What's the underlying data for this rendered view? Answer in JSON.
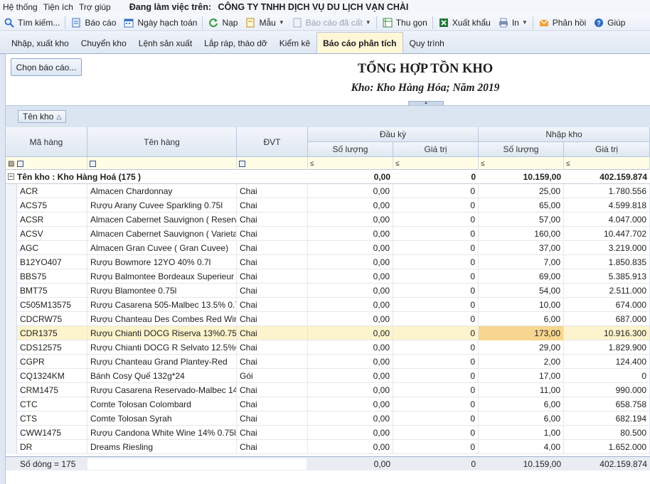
{
  "menu": {
    "items": [
      "Hệ thống",
      "Tiện ích",
      "Trợ giúp"
    ],
    "working_on_label": "Đang làm việc trên:",
    "company": "CÔNG TY TNHH DỊCH VỤ DU LỊCH VẠN CHÀI"
  },
  "toolbar": {
    "search": "Tìm kiếm...",
    "report": "Báo cáo",
    "accounting_date": "Ngày hạch toán",
    "load": "Nạp",
    "template": "Mẫu",
    "saved_report": "Báo cáo đã cất",
    "collapse": "Thu gọn",
    "export": "Xuất khẩu",
    "print": "In",
    "feedback": "Phản hồi",
    "help": "Giúp"
  },
  "tabs": [
    "Nhập, xuất kho",
    "Chuyển kho",
    "Lệnh sản xuất",
    "Lắp ráp, tháo dỡ",
    "Kiểm kê",
    "Báo cáo phân tích",
    "Quy trình"
  ],
  "report": {
    "choose_button": "Chọn báo cáo...",
    "title": "TỔNG HỢP TỒN KHO",
    "subtitle": "Kho: Kho Hàng Hóa; Năm 2019"
  },
  "group_panel": {
    "chip": "Tên kho"
  },
  "columns": {
    "code": "Mã hàng",
    "name": "Tên hàng",
    "unit": "ĐVT",
    "opening": "Đầu kỳ",
    "receipt": "Nhập kho",
    "qty": "Số lượng",
    "value": "Giá trị"
  },
  "filter_lte": "≤",
  "group_row": {
    "label": "Tên kho : Kho Hàng Hoá (175 )",
    "opening_qty": "0,00",
    "opening_value": "0",
    "receipt_qty": "10.159,00",
    "receipt_value": "402.159.874"
  },
  "rows": [
    {
      "code": "ACR",
      "name": "Almacen Chardonnay",
      "unit": "Chai",
      "oq": "0,00",
      "ov": "0",
      "rq": "25,00",
      "rv": "1.780.556"
    },
    {
      "code": "ACS75",
      "name": "Rượu Arany Cuvee Sparkling 0.75l",
      "unit": "Chai",
      "oq": "0,00",
      "ov": "0",
      "rq": "65,00",
      "rv": "4.599.818"
    },
    {
      "code": "ACSR",
      "name": "Almacen Cabernet Sauvignon ( Reserv",
      "unit": "Chai",
      "oq": "0,00",
      "ov": "0",
      "rq": "57,00",
      "rv": "4.047.000"
    },
    {
      "code": "ACSV",
      "name": "Almacen Cabernet Sauvignon ( Varietal",
      "unit": "Chai",
      "oq": "0,00",
      "ov": "0",
      "rq": "160,00",
      "rv": "10.447.702"
    },
    {
      "code": "AGC",
      "name": "Almacen Gran Cuvee ( Gran Cuvee)",
      "unit": "Chai",
      "oq": "0,00",
      "ov": "0",
      "rq": "37,00",
      "rv": "3.219.000"
    },
    {
      "code": "B12YO407",
      "name": "Rượu Bowmore 12YO 40% 0.7l",
      "unit": "Chai",
      "oq": "0,00",
      "ov": "0",
      "rq": "7,00",
      "rv": "1.850.835"
    },
    {
      "code": "BBS75",
      "name": "Rượu Balmontee Bordeaux Superieur 0.",
      "unit": "Chai",
      "oq": "0,00",
      "ov": "0",
      "rq": "69,00",
      "rv": "5.385.913"
    },
    {
      "code": "BMT75",
      "name": "Rượu Blamontee 0.75l",
      "unit": "Chai",
      "oq": "0,00",
      "ov": "0",
      "rq": "54,00",
      "rv": "2.511.000"
    },
    {
      "code": "C505M13575",
      "name": "Rượu Casarena 505-Malbec 13.5% 0.7",
      "unit": "Chai",
      "oq": "0,00",
      "ov": "0",
      "rq": "10,00",
      "rv": "674.000"
    },
    {
      "code": "CDCRW75",
      "name": "Rượu Chanteau Des Combes Red Wine",
      "unit": "Chai",
      "oq": "0,00",
      "ov": "0",
      "rq": "6,00",
      "rv": "687.000"
    },
    {
      "code": "CDR1375",
      "name": "Rượu Chianti DOCG Riserva 13%0.75l",
      "unit": "Chai",
      "oq": "0,00",
      "ov": "0",
      "rq": "173,00",
      "rv": "10.916.300"
    },
    {
      "code": "CDS12575",
      "name": "Rượu Chianti DOCG R Selvato 12.5%0.",
      "unit": "Chai",
      "oq": "0,00",
      "ov": "0",
      "rq": "29,00",
      "rv": "1.829.900"
    },
    {
      "code": "CGPR",
      "name": "Rượu Chanteau Grand Plantey-Red",
      "unit": "Chai",
      "oq": "0,00",
      "ov": "0",
      "rq": "2,00",
      "rv": "124.400"
    },
    {
      "code": "CQ1324KM",
      "name": "Bánh Cosy Quế 132g*24",
      "unit": "Gói",
      "oq": "0,00",
      "ov": "0",
      "rq": "17,00",
      "rv": "0"
    },
    {
      "code": "CRM1475",
      "name": "Rượu Casarena Reservado-Malbec 14",
      "unit": "Chai",
      "oq": "0,00",
      "ov": "0",
      "rq": "11,00",
      "rv": "990.000"
    },
    {
      "code": "CTC",
      "name": "Comte Tolosan Colombard",
      "unit": "Chai",
      "oq": "0,00",
      "ov": "0",
      "rq": "6,00",
      "rv": "658.758"
    },
    {
      "code": "CTS",
      "name": "Comte Tolosan Syrah",
      "unit": "Chai",
      "oq": "0,00",
      "ov": "0",
      "rq": "6,00",
      "rv": "682.194"
    },
    {
      "code": "CWW1475",
      "name": "Rượu Candona White Wine 14% 0.75l",
      "unit": "Chai",
      "oq": "0,00",
      "ov": "0",
      "rq": "1,00",
      "rv": "80.500"
    },
    {
      "code": "DR",
      "name": "Dreams Riesling",
      "unit": "Chai",
      "oq": "0,00",
      "ov": "0",
      "rq": "4,00",
      "rv": "1.652.000"
    }
  ],
  "selected_row_index": 10,
  "footer": {
    "row_count": "Số dòng = 175",
    "opening_qty": "0,00",
    "opening_value": "0",
    "receipt_qty": "10.159,00",
    "receipt_value": "402.159.874"
  }
}
